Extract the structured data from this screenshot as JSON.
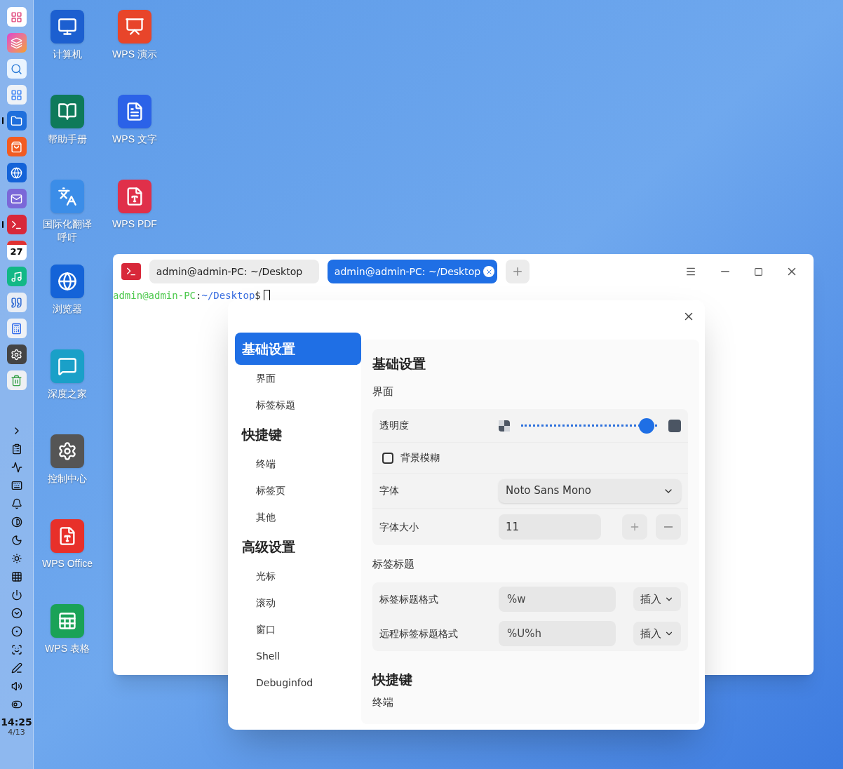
{
  "dock": {
    "apps": [
      {
        "kind": "grid",
        "running": false
      },
      {
        "kind": "swirl",
        "running": false
      },
      {
        "kind": "search",
        "running": false
      },
      {
        "kind": "tiles",
        "running": false
      },
      {
        "kind": "folder",
        "running": true
      },
      {
        "kind": "store",
        "running": false
      },
      {
        "kind": "browser",
        "running": false
      },
      {
        "kind": "mail",
        "running": false
      },
      {
        "kind": "terminal",
        "running": true
      },
      {
        "kind": "calendar",
        "running": false,
        "label": "27"
      },
      {
        "kind": "music",
        "running": false
      },
      {
        "kind": "quote",
        "running": false
      },
      {
        "kind": "calculator",
        "running": false
      },
      {
        "kind": "settings",
        "running": false
      },
      {
        "kind": "trash",
        "running": false
      }
    ],
    "tray": [
      {
        "kind": "chevron"
      },
      {
        "kind": "clipboard"
      },
      {
        "kind": "wave"
      },
      {
        "kind": "keyboard"
      },
      {
        "kind": "bell"
      },
      {
        "kind": "contrast"
      },
      {
        "kind": "moon"
      },
      {
        "kind": "brightness"
      },
      {
        "kind": "keypad"
      },
      {
        "kind": "power"
      },
      {
        "kind": "down"
      },
      {
        "kind": "record"
      },
      {
        "kind": "screenshot"
      },
      {
        "kind": "pen"
      },
      {
        "kind": "volume"
      },
      {
        "kind": "toggle"
      }
    ],
    "time": "14:25",
    "date": "4/13"
  },
  "desktop_columns": [
    {
      "icons": [
        {
          "label": "计算机",
          "kind": "monitor"
        },
        {
          "label": "帮助手册",
          "kind": "help"
        },
        {
          "label": "国际化翻译呼吁",
          "kind": "translate"
        },
        {
          "label": "浏览器",
          "kind": "browser"
        },
        {
          "label": "深度之家",
          "kind": "chat"
        },
        {
          "label": "控制中心",
          "kind": "settings"
        },
        {
          "label": "WPS Office",
          "kind": "wps"
        },
        {
          "label": "WPS 表格",
          "kind": "sheet"
        }
      ]
    },
    {
      "icons": [
        {
          "label": "WPS 演示",
          "kind": "slides"
        },
        {
          "label": "WPS 文字",
          "kind": "doc"
        },
        {
          "label": "WPS PDF",
          "kind": "pdf"
        }
      ]
    }
  ],
  "terminal": {
    "tabs": [
      {
        "label": "admin@admin-PC: ~/Desktop",
        "selected": false
      },
      {
        "label": "admin@admin-PC: ~/Desktop",
        "selected": true
      }
    ],
    "prompt": {
      "user": "admin@admin-PC",
      "sep": ":",
      "path": "~/Desktop",
      "symbol": "$"
    }
  },
  "settings_dialog": {
    "nav": [
      {
        "label": "基础设置",
        "kind": "group",
        "selected": true
      },
      {
        "label": "界面",
        "kind": "item",
        "selected": false
      },
      {
        "label": "标签标题",
        "kind": "item",
        "selected": false
      },
      {
        "label": "快捷键",
        "kind": "group",
        "selected": false
      },
      {
        "label": "终端",
        "kind": "item",
        "selected": false
      },
      {
        "label": "标签页",
        "kind": "item",
        "selected": false
      },
      {
        "label": "其他",
        "kind": "item",
        "selected": false
      },
      {
        "label": "高级设置",
        "kind": "group",
        "selected": false
      },
      {
        "label": "光标",
        "kind": "item",
        "selected": false
      },
      {
        "label": "滚动",
        "kind": "item",
        "selected": false
      },
      {
        "label": "窗口",
        "kind": "item",
        "selected": false
      },
      {
        "label": "Shell",
        "kind": "item",
        "selected": false
      },
      {
        "label": "Debuginfod",
        "kind": "item",
        "selected": false
      }
    ],
    "title": "基础设置",
    "sections": [
      {
        "heading": "界面",
        "rows": [
          {
            "kind": "slider",
            "label": "透明度",
            "level": 0.98
          },
          {
            "kind": "checkbox",
            "label": "背景模糊",
            "checked": false
          },
          {
            "kind": "select",
            "label": "字体",
            "value": "Noto Sans Mono"
          },
          {
            "kind": "spin",
            "label": "字体大小",
            "value": "11"
          }
        ]
      },
      {
        "heading": "标签标题",
        "rows": [
          {
            "kind": "format",
            "label": "标签标题格式",
            "value": "%w",
            "button": "插入"
          },
          {
            "kind": "format",
            "label": "远程标签标题格式",
            "value": "%U%h",
            "button": "插入"
          }
        ]
      }
    ],
    "next_title": "快捷键",
    "next_heading": "终端"
  }
}
